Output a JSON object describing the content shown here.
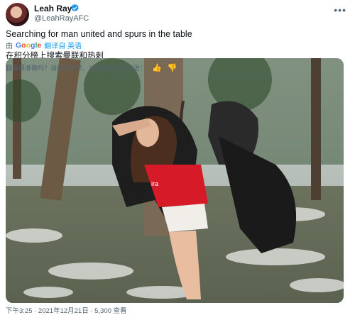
{
  "user": {
    "name": "Leah Ray",
    "handle": "@LeahRayAFC"
  },
  "tweet": {
    "text": "Searching for man united and spurs in the table",
    "translated_by": "由",
    "google_letters": [
      "G",
      "o",
      "o",
      "g",
      "l",
      "e"
    ],
    "translated_by_suffix": "翻译自 英语",
    "translated_text": "在积分榜上搜索曼联和热刺",
    "feedback_prompt": "翻译得准确吗？请提供反馈，以便我们加以改进："
  },
  "footer": {
    "meta": "下午3:25 · 2021年12月21日 · 5,300 查看"
  },
  "colors": {
    "verified": "#1d9bf0",
    "link": "#1d9bf0",
    "jersey": "#d71a28"
  },
  "icons": {
    "more": "more-icon",
    "verified": "verified-badge-icon",
    "thumbs_up": "thumbs-up-icon",
    "thumbs_down": "thumbs-down-icon"
  }
}
